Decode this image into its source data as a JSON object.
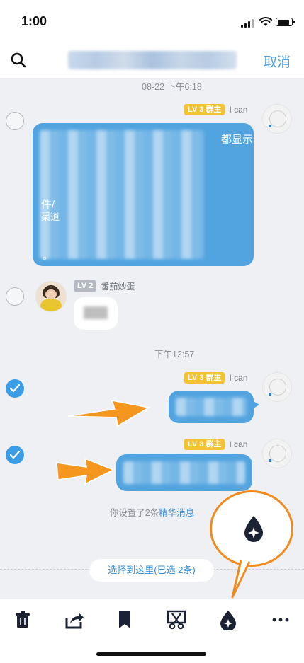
{
  "status_bar": {
    "time": "1:00"
  },
  "header": {
    "title_blurred": "",
    "cancel_label": "取消"
  },
  "messages": [
    {
      "timestamp": "08-22 下午6:18"
    },
    {
      "level": "LV 3",
      "role": "群主",
      "name": "I can",
      "visible_text_1": "都显示",
      "visible_text_2": "件/",
      "visible_text_3": "渠道",
      "visible_text_4": "。",
      "selected": false
    },
    {
      "level": "LV 2",
      "name": "番茄炒蛋",
      "selected": false
    },
    {
      "timestamp": "下午12:57"
    },
    {
      "level": "LV 3",
      "role": "群主",
      "name": "I can",
      "selected": true
    },
    {
      "level": "LV 3",
      "role": "群主",
      "name": "I can",
      "selected": true
    }
  ],
  "notice": {
    "prefix": "你设置了2条",
    "link": "精华消息"
  },
  "select_pill": "选择到这里(已选 2条)",
  "toolbar": {
    "items": [
      {
        "icon": "trash-icon"
      },
      {
        "icon": "share-icon"
      },
      {
        "icon": "bookmark-icon"
      },
      {
        "icon": "scissors-icon"
      },
      {
        "icon": "essence-drop-icon"
      },
      {
        "icon": "more-icon"
      }
    ]
  },
  "colors": {
    "accent": "#4a9fdc",
    "bubble": "#52a4e0",
    "level_gold": "#f2c232",
    "arrow": "#f08a1c"
  }
}
